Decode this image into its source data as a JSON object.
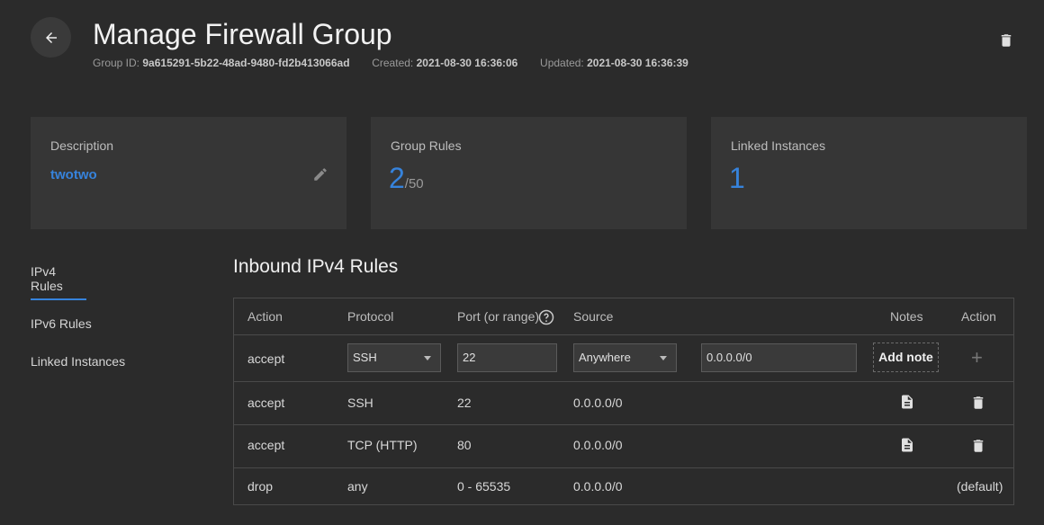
{
  "header": {
    "title": "Manage Firewall Group",
    "group_id_label": "Group ID:",
    "group_id": "9a615291-5b22-48ad-9480-fd2b413066ad",
    "created_label": "Created:",
    "created": "2021-08-30 16:36:06",
    "updated_label": "Updated:",
    "updated": "2021-08-30 16:36:39"
  },
  "cards": {
    "description": {
      "label": "Description",
      "value": "twotwo"
    },
    "group_rules": {
      "label": "Group Rules",
      "count": "2",
      "max": "/50"
    },
    "linked_instances": {
      "label": "Linked Instances",
      "count": "1"
    }
  },
  "sidebar": {
    "items": [
      {
        "label": "IPv4 Rules"
      },
      {
        "label": "IPv6 Rules"
      },
      {
        "label": "Linked Instances"
      }
    ]
  },
  "section_title": "Inbound IPv4 Rules",
  "table": {
    "headers": {
      "action": "Action",
      "protocol": "Protocol",
      "port": "Port (or range)",
      "source": "Source",
      "notes": "Notes",
      "action2": "Action"
    },
    "new_rule": {
      "action": "accept",
      "protocol": "SSH",
      "port": "22",
      "source_select": "Anywhere",
      "source_value": "0.0.0.0/0",
      "add_note": "Add note",
      "add_symbol": "+"
    },
    "rows": [
      {
        "action": "accept",
        "protocol": "SSH",
        "port": "22",
        "source": "0.0.0.0/0"
      },
      {
        "action": "accept",
        "protocol": "TCP (HTTP)",
        "port": "80",
        "source": "0.0.0.0/0"
      },
      {
        "action": "drop",
        "protocol": "any",
        "port": "0 - 65535",
        "source": "0.0.0.0/0",
        "action_text": "(default)"
      }
    ]
  },
  "colors": {
    "accent": "#3683dc",
    "background": "#2b2b2b",
    "card": "#363636"
  },
  "icons": [
    "arrow-left-icon",
    "trash-icon",
    "pencil-icon",
    "help-circle-icon",
    "note-icon"
  ]
}
